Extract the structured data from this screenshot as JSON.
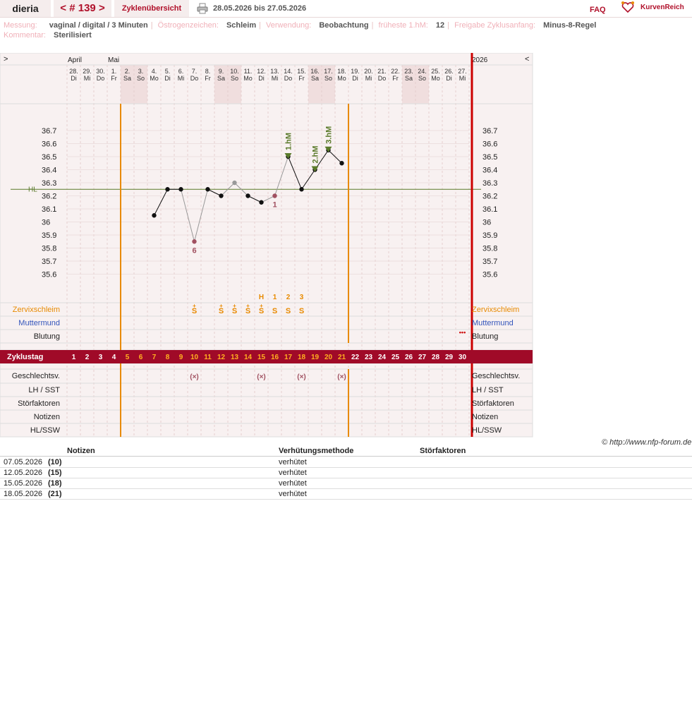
{
  "header": {
    "user": "dieria",
    "cycle_prev": "<",
    "cycle_label": "# 139",
    "cycle_next": ">",
    "overview": "Zyklenübersicht",
    "date_range": "28.05.2026 bis 27.05.2026",
    "faq": "FAQ",
    "brand": "KurvenReich",
    "print_icon": "printer-icon",
    "logo_icon": "heart-logo-icon"
  },
  "info": {
    "messung_label": "Messung:",
    "messung_value": "vaginal / digital / 3 Minuten",
    "oestrogen_label": "Östrogenzeichen:",
    "oestrogen_value": "Schleim",
    "verwendung_label": "Verwendung:",
    "verwendung_value": "Beobachtung",
    "frueheste_label": "früheste 1.hM:",
    "frueheste_value": "12",
    "freigabe_label": "Freigabe Zyklusanfang:",
    "freigabe_value": "Minus-8-Regel",
    "kommentar_label": "Kommentar:",
    "kommentar_value": "Sterilisiert"
  },
  "colors": {
    "accent": "#b0102a",
    "orange": "#e88a00",
    "green": "#5a7a2a",
    "grid_bg": "#f8f1f1",
    "weekend": "#f0dede"
  },
  "chart_data": {
    "type": "line",
    "nav_left": ">",
    "nav_right": "<",
    "year": "2026",
    "months": [
      {
        "label": "April",
        "col": 0
      },
      {
        "label": "Mai",
        "col": 3
      }
    ],
    "dates": [
      "28.",
      "29.",
      "30.",
      "1.",
      "2.",
      "3.",
      "4.",
      "5.",
      "6.",
      "7.",
      "8.",
      "9.",
      "10.",
      "11.",
      "12.",
      "13.",
      "14.",
      "15.",
      "16.",
      "17.",
      "18.",
      "19.",
      "20.",
      "21.",
      "22.",
      "23.",
      "24.",
      "25.",
      "26.",
      "27."
    ],
    "weekdays": [
      "Di",
      "Mi",
      "Do",
      "Fr",
      "Sa",
      "So",
      "Mo",
      "Di",
      "Mi",
      "Do",
      "Fr",
      "Sa",
      "So",
      "Mo",
      "Di",
      "Mi",
      "Do",
      "Fr",
      "Sa",
      "So",
      "Mo",
      "Di",
      "Mi",
      "Do",
      "Fr",
      "Sa",
      "So",
      "Mo",
      "Di",
      "Mi"
    ],
    "shaded_cols": [
      4,
      5,
      11,
      12,
      18,
      19,
      25,
      26
    ],
    "cycle_days": [
      "1",
      "2",
      "3",
      "4",
      "5",
      "6",
      "7",
      "8",
      "9",
      "10",
      "11",
      "12",
      "13",
      "14",
      "15",
      "16",
      "17",
      "18",
      "19",
      "20",
      "21",
      "22",
      "23",
      "24",
      "25",
      "26",
      "27",
      "28",
      "29",
      "30"
    ],
    "ylim": [
      35.5,
      36.8
    ],
    "yticks": [
      "36.7",
      "36.6",
      "36.5",
      "36.4",
      "36.3",
      "36.2",
      "36.1",
      "36",
      "35.9",
      "35.8",
      "35.7",
      "35.6"
    ],
    "hl_label": "HL",
    "hl_value": 36.25,
    "series": [
      {
        "values": [
          null,
          null,
          null,
          null,
          null,
          null,
          36.05,
          36.25,
          36.25,
          35.85,
          36.25,
          36.2,
          36.3,
          36.2,
          36.15,
          36.2,
          36.5,
          36.25,
          36.4,
          36.55,
          36.45,
          null,
          null,
          null,
          null,
          null,
          null,
          null,
          null,
          null
        ],
        "excluded": [
          9,
          12,
          15
        ]
      }
    ],
    "point_labels": [
      {
        "col": 9,
        "text": "6"
      },
      {
        "col": 15,
        "text": "1"
      }
    ],
    "markers": [
      {
        "col": 16,
        "text": "1.hM"
      },
      {
        "col": 18,
        "text": "2.hM"
      },
      {
        "col": 19,
        "text": "3.hM"
      }
    ],
    "peak_labels": [
      {
        "col": 14,
        "text": "H"
      },
      {
        "col": 15,
        "text": "1"
      },
      {
        "col": 16,
        "text": "2"
      },
      {
        "col": 17,
        "text": "3"
      }
    ],
    "mucus_cols": [
      9,
      11,
      12,
      13,
      14,
      15,
      16,
      17
    ],
    "mucus_plus_cols": [
      9,
      11,
      12,
      13,
      14
    ],
    "mucus_symbol": "S",
    "bleeding_col": 29,
    "bleeding_mark": "•••",
    "sex_cols": [
      9,
      14,
      17,
      20
    ],
    "sex_symbol": "(×)",
    "start_col": 4,
    "end_col": 20,
    "row_labels": {
      "zervix": "Zervixschleim",
      "muttermund": "Muttermund",
      "blutung": "Blutung",
      "zyklustag": "Zyklustag",
      "gv": "Geschlechtsv.",
      "lh": "LH / SST",
      "stoer": "Störfaktoren",
      "notizen": "Notizen",
      "hl": "HL/SSW"
    }
  },
  "copyright": "© http://www.nfp-forum.de",
  "notes_table": {
    "headers": [
      "Notizen",
      "Verhütungsmethode",
      "Störfaktoren"
    ],
    "rows": [
      {
        "date": "07.05.2026",
        "day": "(10)",
        "method": "verhütet"
      },
      {
        "date": "12.05.2026",
        "day": "(15)",
        "method": "verhütet"
      },
      {
        "date": "15.05.2026",
        "day": "(18)",
        "method": "verhütet"
      },
      {
        "date": "18.05.2026",
        "day": "(21)",
        "method": "verhütet"
      }
    ]
  }
}
